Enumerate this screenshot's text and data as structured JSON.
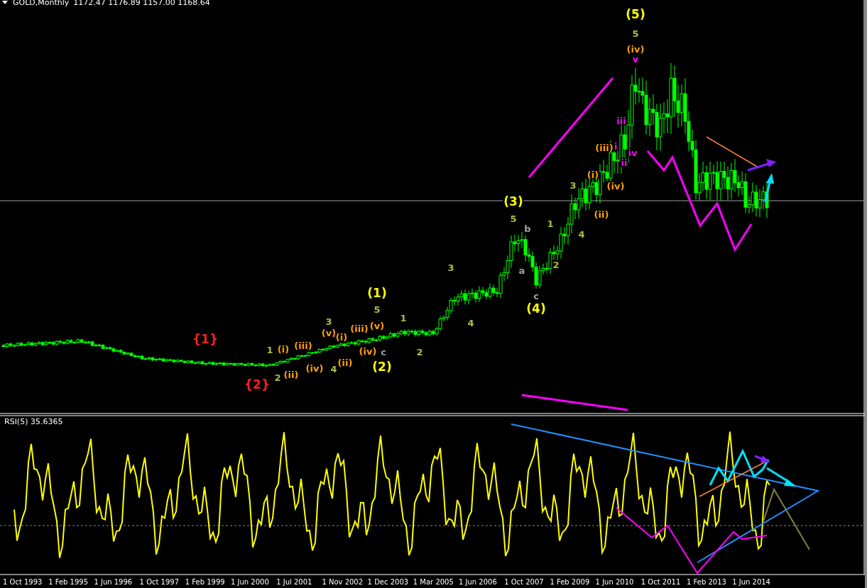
{
  "chart_header": {
    "title": "GOLD,Monthly",
    "ohlc": "1172.47 1176.89 1157.00 1168.64"
  },
  "wave_labels": [
    {
      "text": "{1}",
      "color": "#ff2020"
    },
    {
      "text": "{2}",
      "color": "#ff2020"
    },
    {
      "text": "1",
      "color": "#a8c040"
    },
    {
      "text": "(i)",
      "color": "#ffa000"
    },
    {
      "text": "2",
      "color": "#a8c040"
    },
    {
      "text": "(ii)",
      "color": "#ffa000"
    },
    {
      "text": "(iii)",
      "color": "#ffa000"
    },
    {
      "text": "(iv)",
      "color": "#ffa000"
    },
    {
      "text": "3",
      "color": "#a8c040"
    },
    {
      "text": "(v)",
      "color": "#ffa000"
    },
    {
      "text": "4",
      "color": "#a8c040"
    },
    {
      "text": "(i)",
      "color": "#ffa000"
    },
    {
      "text": "(ii)",
      "color": "#ffa000"
    },
    {
      "text": "(iii)",
      "color": "#ffa000"
    },
    {
      "text": "(1)",
      "color": "#ffff00"
    },
    {
      "text": "5",
      "color": "#a8c040"
    },
    {
      "text": "(v)",
      "color": "#ffa000"
    },
    {
      "text": "(iv)",
      "color": "#ffa000"
    },
    {
      "text": "c",
      "color": "#a0a0a0"
    },
    {
      "text": "(2)",
      "color": "#ffff00"
    },
    {
      "text": "1",
      "color": "#a8c040"
    },
    {
      "text": "2",
      "color": "#a8c040"
    },
    {
      "text": "3",
      "color": "#a8c040"
    },
    {
      "text": "4",
      "color": "#a8c040"
    },
    {
      "text": "(3)",
      "color": "#ffff00"
    },
    {
      "text": "5",
      "color": "#a8c040"
    },
    {
      "text": "b",
      "color": "#a0a0a0"
    },
    {
      "text": "a",
      "color": "#a0a0a0"
    },
    {
      "text": "c",
      "color": "#a0a0a0"
    },
    {
      "text": "(4)",
      "color": "#ffff00"
    },
    {
      "text": "1",
      "color": "#a8c040"
    },
    {
      "text": "2",
      "color": "#a8c040"
    },
    {
      "text": "3",
      "color": "#a8c040"
    },
    {
      "text": "4",
      "color": "#a8c040"
    },
    {
      "text": "(5)",
      "color": "#ffff00"
    },
    {
      "text": "5",
      "color": "#a8c040"
    },
    {
      "text": "(iv)",
      "color": "#ffa000"
    },
    {
      "text": "v",
      "color": "#ff00ff"
    },
    {
      "text": "iii",
      "color": "#ff00ff"
    },
    {
      "text": "i",
      "color": "#ff00ff"
    },
    {
      "text": "(iii)",
      "color": "#ffa000"
    },
    {
      "text": "iv",
      "color": "#ff00ff"
    },
    {
      "text": "ii",
      "color": "#ff00ff"
    },
    {
      "text": "(i)",
      "color": "#ffa000"
    },
    {
      "text": "(iv)",
      "color": "#ffa000"
    },
    {
      "text": "(ii)",
      "color": "#ffa000"
    }
  ],
  "indicator": {
    "label": "RSI(5) 35.6365"
  },
  "time_axis": [
    "1 Oct 1993",
    "1 Feb 1995",
    "1 Jun 1996",
    "1 Oct 1997",
    "1 Feb 1999",
    "1 Jun 2000",
    "1 Jul 2001",
    "1 Nov 2002",
    "1 Dec 2003",
    "1 Mar 2005",
    "1 Jun 2006",
    "1 Oct 2007",
    "1 Feb 2009",
    "1 Jun 2010",
    "1 Oct 2011",
    "1 Feb 2013",
    "1 Jun 2014"
  ]
}
